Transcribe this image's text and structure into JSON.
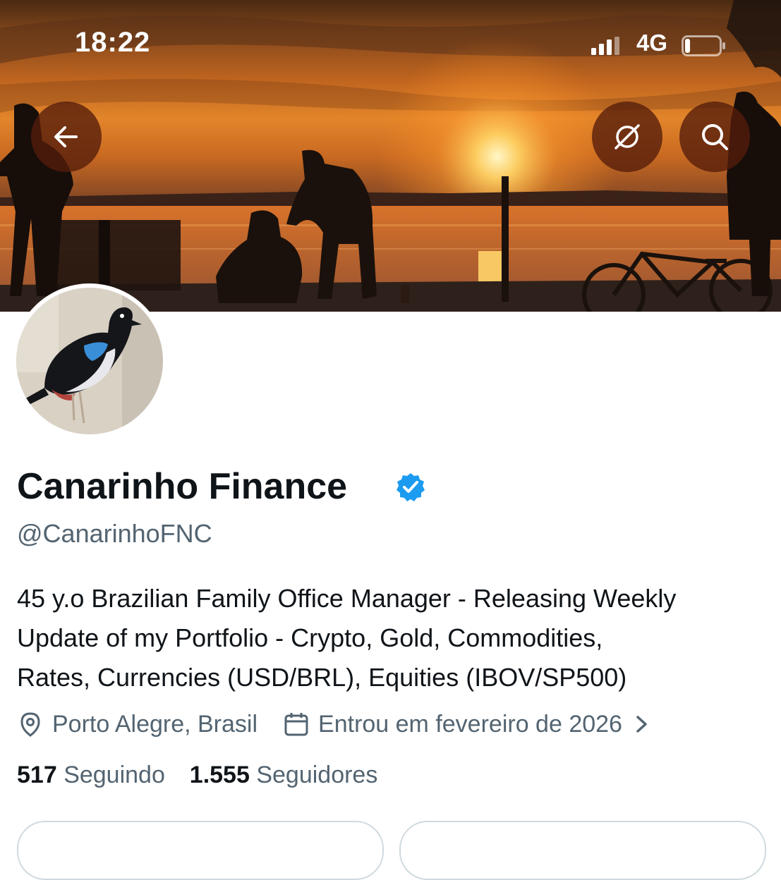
{
  "status_bar": {
    "time": "18:22",
    "network": "4G",
    "signal_icon": "signal-bars-icon",
    "battery_icon": "battery-low-icon",
    "battery_level": 0.15
  },
  "header": {
    "back_icon": "arrow-left-icon",
    "follow_notifications_icon": "bell-slash-icon",
    "search_icon": "search-icon"
  },
  "profile": {
    "display_name": "Canarinho Finance",
    "verified": true,
    "verified_color": "#1d9bf0",
    "handle": "@CanarinhoFNC",
    "bio_lines": [
      "45 y.o Brazilian Family Office Manager - Releasing Weekly",
      "Update of my Portfolio - Crypto, Gold, Commodities,",
      "Rates, Currencies (USD/BRL), Equities (IBOV/SP500)"
    ],
    "location": "Porto Alegre, Brasil",
    "joined": "Entrou em fevereiro de 2026",
    "following_count": "517",
    "following_label": "Seguindo",
    "followers_count": "1.555",
    "followers_label": "Seguidores"
  },
  "colors": {
    "text_primary": "#0f1419",
    "text_secondary": "#536471",
    "accent": "#1d9bf0"
  }
}
